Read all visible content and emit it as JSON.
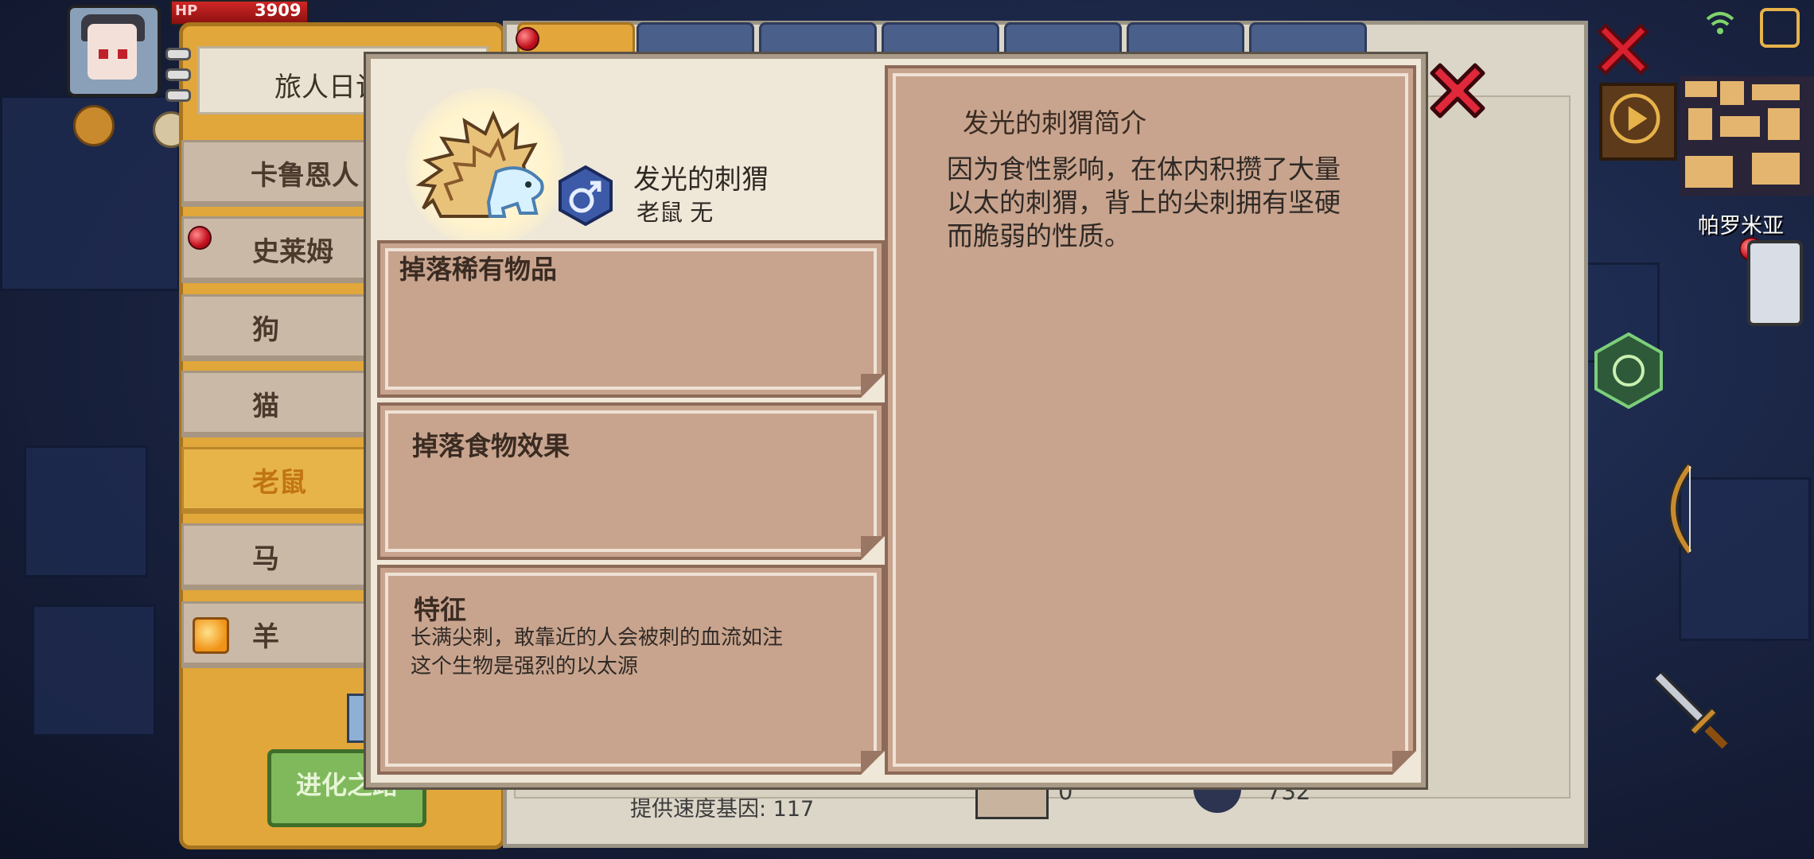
{
  "hud": {
    "hp_label": "HP",
    "hp_value": "3909",
    "place": "帕罗米亚"
  },
  "journal": {
    "title": "旅人日记",
    "categories": [
      {
        "label": "卡鲁恩人",
        "active": false
      },
      {
        "label": "史莱姆",
        "active": false
      },
      {
        "label": "狗",
        "active": false
      },
      {
        "label": "猫",
        "active": false
      },
      {
        "label": "老鼠",
        "active": true
      },
      {
        "label": "马",
        "active": false
      },
      {
        "label": "羊",
        "active": false
      }
    ],
    "evolve_button": "进化之路"
  },
  "back_panel": {
    "footer_stat": "提供速度基因: 117",
    "count_a": "0",
    "count_b": "732"
  },
  "modal": {
    "creature_name": "发光的刺猬",
    "creature_type": "老鼠 无",
    "gender_icon": "male-symbol",
    "drops_title": "掉落稀有物品",
    "food_title": "掉落食物效果",
    "trait_title": "特征",
    "trait_lines": [
      "长满尖刺，敢靠近的人会被刺的血流如注",
      "这个生物是强烈的以太源"
    ],
    "desc_title": "发光的刺猬简介",
    "desc_lines": [
      "因为食性影响，在体内积攒了大量",
      "以太的刺猬，背上的尖刺拥有坚硬",
      "而脆弱的性质。"
    ]
  },
  "colors": {
    "accent": "#e2a63b",
    "close_red": "#d8202e",
    "card": "#c8a48e"
  }
}
